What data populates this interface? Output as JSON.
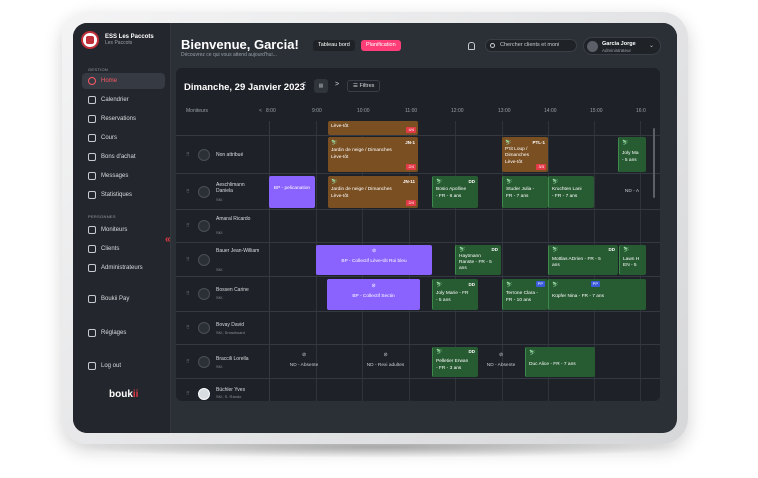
{
  "brand": {
    "name": "ESS Les Paccots",
    "sub": "Les Paccots"
  },
  "sidebar": {
    "section1": "GESTION",
    "items1": [
      {
        "label": "Home",
        "icon": "home-icon"
      },
      {
        "label": "Calendrier",
        "icon": "calendar-icon"
      },
      {
        "label": "Reservations",
        "icon": "reservations-icon"
      },
      {
        "label": "Cours",
        "icon": "courses-icon"
      },
      {
        "label": "Bons d'achat",
        "icon": "voucher-icon"
      },
      {
        "label": "Messages",
        "icon": "messages-icon"
      },
      {
        "label": "Statistiques",
        "icon": "stats-icon"
      }
    ],
    "section2": "PERSONNES",
    "items2": [
      {
        "label": "Moniteurs",
        "icon": "monitors-icon"
      },
      {
        "label": "Clients",
        "icon": "clients-icon"
      },
      {
        "label": "Administrateurs",
        "icon": "admins-icon"
      }
    ],
    "pay": "Boukii Pay",
    "settings": "Réglages",
    "logout": "Log out",
    "logo_main": "bouk",
    "logo_accent": "ii",
    "collapse": "«"
  },
  "header": {
    "title": "Bienvenue, Garcia!",
    "subtitle": "Découvrez ce qui vous attend aujourd'hui...",
    "tab1": "Tableau bord",
    "tab2": "Planification",
    "search_placeholder": "Chercher clients et moni",
    "user_name": "Garcia Jorge",
    "user_role": "Administrateur",
    "chevron": "⌄"
  },
  "planner": {
    "date": "Dimanche, 29 Janvier 2023",
    "prev": "<",
    "next": ">",
    "cal_icon": "▦",
    "filter": "☰ Filtres",
    "col_header": "Moniteurs",
    "hour_prev": "<",
    "hours": [
      "8:00",
      "9:00",
      "10:00",
      "11:00",
      "12:00",
      "13:00",
      "14:00",
      "15:00",
      "16:0"
    ],
    "rows": [
      {
        "name": "Non attribué",
        "sport": "",
        "photo": false
      },
      {
        "name": "Aeschlimann Daniela",
        "sport": "SKI",
        "photo": false
      },
      {
        "name": "Amaral Ricardo",
        "sport": "SKI",
        "photo": false
      },
      {
        "name": "Bauer Jean-William",
        "sport": "SKI",
        "photo": false
      },
      {
        "name": "Bossen Carine",
        "sport": "SKI",
        "photo": false
      },
      {
        "name": "Bovay David",
        "sport": "SKI, Snowboard",
        "photo": false
      },
      {
        "name": "Braccili Lorella",
        "sport": "SKI",
        "photo": false
      },
      {
        "name": "Büchler Yves",
        "sport": "SKI, S. Rando",
        "photo": true
      }
    ],
    "events": {
      "e_top": {
        "text": "Lève-tôt",
        "tag": "4/4"
      },
      "e1": {
        "badge": "JN-1",
        "line1": "Jardin de neige / Dimanches",
        "line2": "Lève-tôt",
        "tag": "2/4"
      },
      "e2": {
        "badge": "PTL-1",
        "line1": "P'tit Loup / Dimanches",
        "line2": "Lève-tôt",
        "tag": "3/3"
      },
      "e3": {
        "badge": "",
        "line1": "Joly Ma",
        "line2": "- 5 ans"
      },
      "e4": {
        "line1": "BP - pelicanation"
      },
      "e5": {
        "badge": "JN-11",
        "line1": "Jardin de neige / Dimanches",
        "line2": "Lève-tôt",
        "tag": "2/4"
      },
      "e6": {
        "badge": "DD",
        "line1": "Bosio Apolline",
        "line2": "- FR - 6 ans"
      },
      "e7": {
        "line1": "Studer Julia -",
        "line2": "FR - 7 ans"
      },
      "e8": {
        "line1": "Kruchten Lani",
        "line2": "- FR - 7 ans"
      },
      "e9": {
        "line1": "ND - A"
      },
      "e10": {
        "line1": "BP - Collectif Lève-tôt Roi bleu"
      },
      "e11": {
        "badge": "DD",
        "line1": "Haytmann",
        "line2": "Ranste - FR - 5",
        "line3": "ans"
      },
      "e12": {
        "badge": "DD",
        "line1": "Mottlas ADrien - FR - 5",
        "line2": "ans"
      },
      "e13": {
        "line1": "Lawn H",
        "line2": "EN - 5"
      },
      "e14": {
        "line1": "BP - Collectif Sectin"
      },
      "e15": {
        "badge": "DD",
        "line1": "Joly Marie - FR",
        "line2": "- 5 ans"
      },
      "e16": {
        "badge": "PP",
        "line1": "Terrone Clara -",
        "line2": "FR - 10 ans"
      },
      "e17": {
        "badge": "PP",
        "line1": "Küpfer Nina - FR - 7 ans"
      },
      "e18": {
        "line1": "ND - Absente"
      },
      "e19": {
        "line1": "ND - Rexi adultes"
      },
      "e20": {
        "badge": "DD",
        "line1": "Pelletier Erwan",
        "line2": "- FR - 3 ans"
      },
      "e21": {
        "line1": "ND - Absente"
      },
      "e22": {
        "line1": "Duc Alice - FR - 7 ans"
      }
    }
  }
}
